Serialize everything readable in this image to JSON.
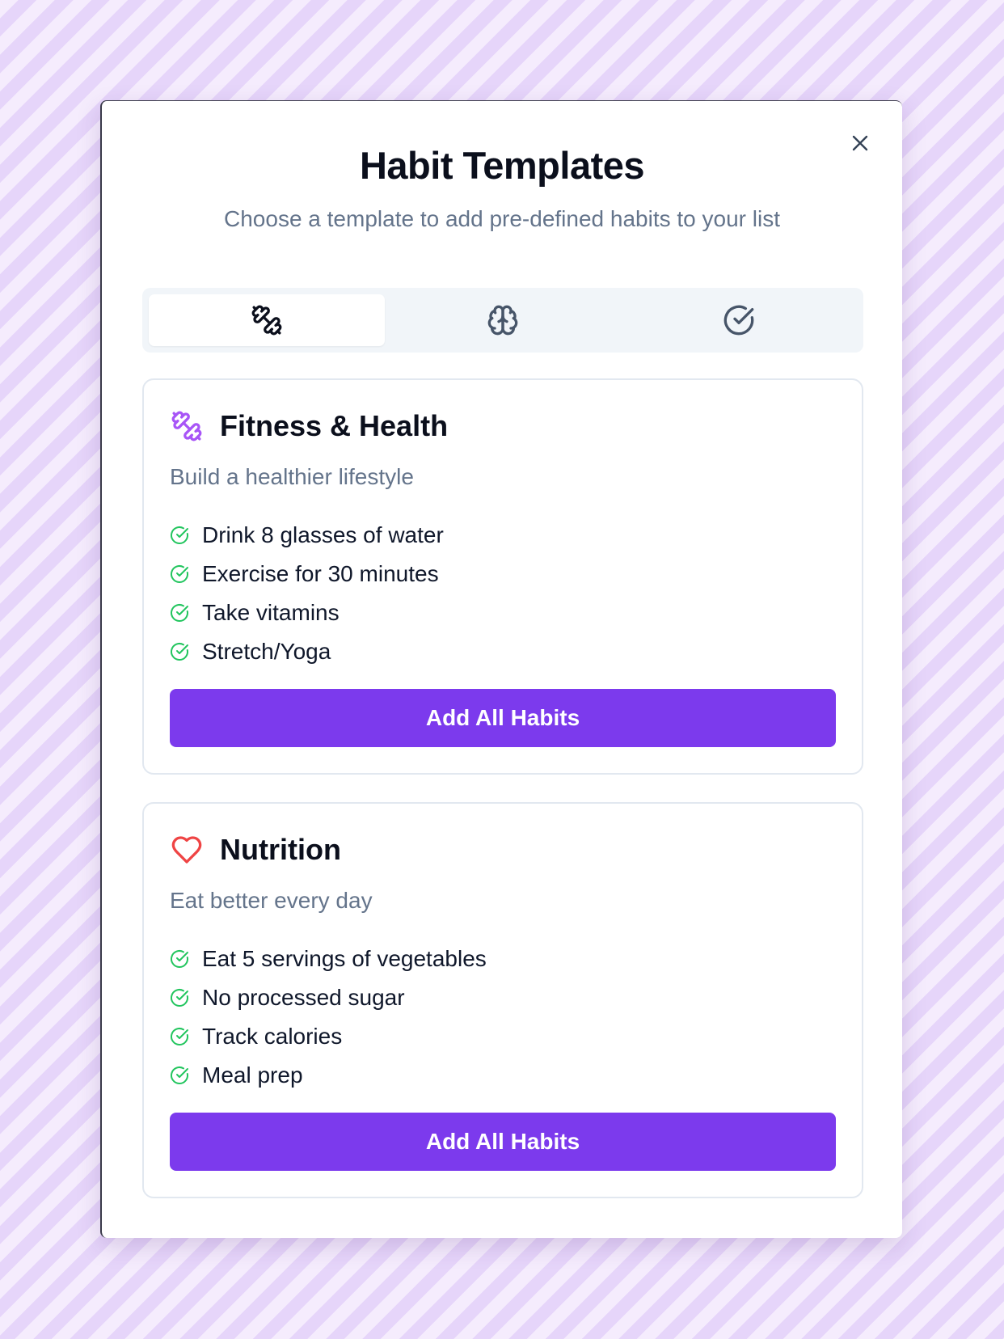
{
  "modal": {
    "title": "Habit Templates",
    "subtitle": "Choose a template to add pre-defined habits to your list"
  },
  "tabs": [
    {
      "icon": "dumbbell-icon",
      "active": true
    },
    {
      "icon": "brain-icon",
      "active": false
    },
    {
      "icon": "check-circle-icon",
      "active": false
    }
  ],
  "templates": [
    {
      "icon": "dumbbell-icon",
      "icon_color": "#a855f7",
      "title": "Fitness & Health",
      "description": "Build a healthier lifestyle",
      "habits": [
        "Drink 8 glasses of water",
        "Exercise for 30 minutes",
        "Take vitamins",
        "Stretch/Yoga"
      ],
      "button_label": "Add All Habits"
    },
    {
      "icon": "heart-icon",
      "icon_color": "#ef4444",
      "title": "Nutrition",
      "description": "Eat better every day",
      "habits": [
        "Eat 5 servings of vegetables",
        "No processed sugar",
        "Track calories",
        "Meal prep"
      ],
      "button_label": "Add All Habits"
    }
  ],
  "colors": {
    "accent": "#7c3aed",
    "check": "#22c55e"
  }
}
